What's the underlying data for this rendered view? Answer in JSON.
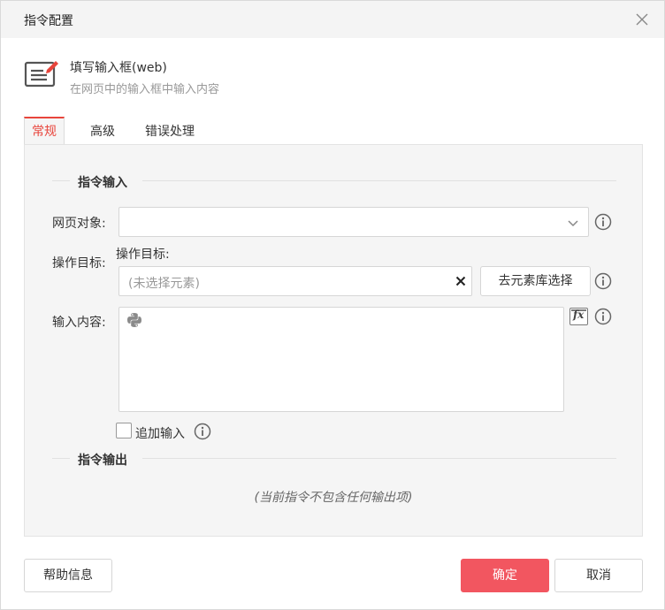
{
  "dialog": {
    "title": "指令配置"
  },
  "command": {
    "name": "填写输入框(web)",
    "description": "在网页中的输入框中输入内容"
  },
  "tabs": [
    {
      "label": "常规",
      "active": true
    },
    {
      "label": "高级",
      "active": false
    },
    {
      "label": "错误处理",
      "active": false
    }
  ],
  "input_section": {
    "title": "指令输入",
    "web_object_label": "网页对象:",
    "web_object_value": "",
    "target_label": "操作目标:",
    "target_sub_label": "操作目标:",
    "target_placeholder": "(未选择元素)",
    "choose_button": "去元素库选择",
    "content_label": "输入内容:",
    "content_value": "",
    "append_label": "追加输入",
    "append_checked": false
  },
  "output_section": {
    "title": "指令输出",
    "empty_note": "(当前指令不包含任何输出项)"
  },
  "footer": {
    "help_button": "帮助信息",
    "confirm_button": "确定",
    "cancel_button": "取消"
  },
  "colors": {
    "accent": "#e8453c",
    "primary_button": "#f25660",
    "panel_bg": "#f5f5f5"
  }
}
